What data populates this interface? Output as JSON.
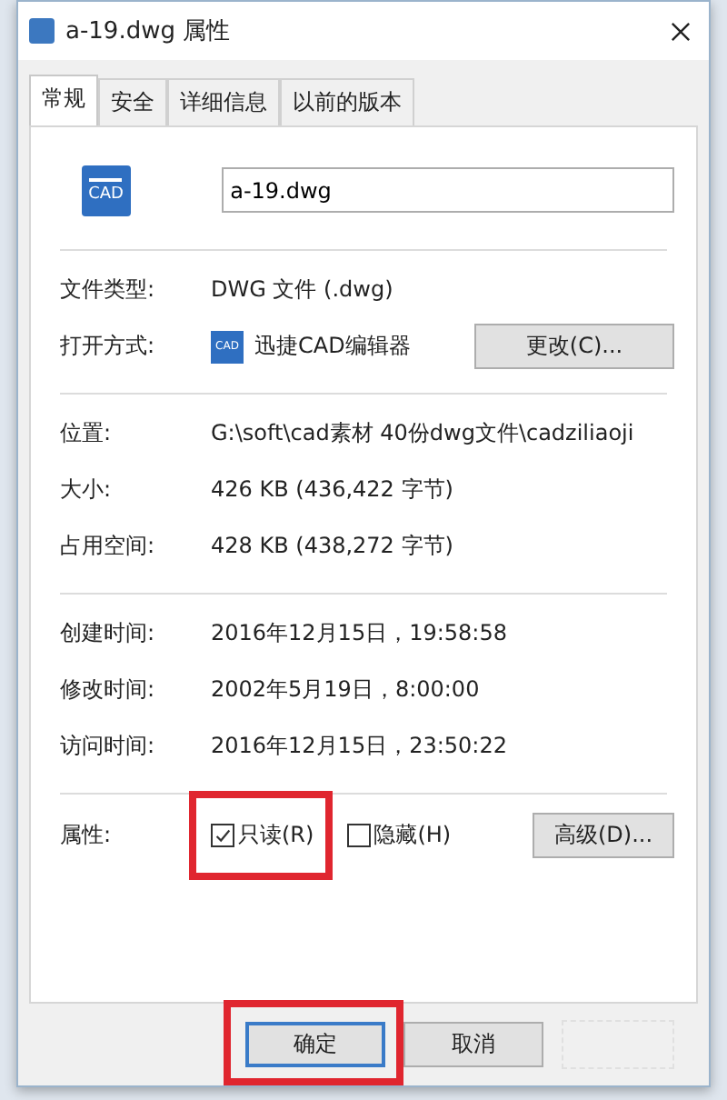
{
  "window": {
    "title": "a-19.dwg 属性"
  },
  "tabs": [
    {
      "label": "常规",
      "selected": true
    },
    {
      "label": "安全",
      "selected": false
    },
    {
      "label": "详细信息",
      "selected": false
    },
    {
      "label": "以前的版本",
      "selected": false
    }
  ],
  "file": {
    "icon_text": "CAD",
    "name": "a-19.dwg"
  },
  "sections": [
    {
      "rows": [
        {
          "kind": "text",
          "label": "文件类型:",
          "value": "DWG 文件 (.dwg)"
        },
        {
          "kind": "app",
          "label": "打开方式:",
          "icon_text": "CAD",
          "value": "迅捷CAD编辑器",
          "button": "更改(C)..."
        }
      ]
    },
    {
      "rows": [
        {
          "kind": "text",
          "label": "位置:",
          "value": "G:\\soft\\cad素材 40份dwg文件\\cadziliaoji"
        },
        {
          "kind": "text",
          "label": "大小:",
          "value": "426 KB (436,422 字节)"
        },
        {
          "kind": "text",
          "label": "占用空间:",
          "value": "428 KB (438,272 字节)"
        }
      ]
    },
    {
      "rows": [
        {
          "kind": "text",
          "label": "创建时间:",
          "value": "2016年12月15日，19:58:58"
        },
        {
          "kind": "text",
          "label": "修改时间:",
          "value": "2002年5月19日，8:00:00"
        },
        {
          "kind": "text",
          "label": "访问时间:",
          "value": "2016年12月15日，23:50:22"
        }
      ]
    }
  ],
  "attributes": {
    "label": "属性:",
    "checkboxes": [
      {
        "label": "只读(R)",
        "checked": true,
        "highlighted": true
      },
      {
        "label": "隐藏(H)",
        "checked": false,
        "highlighted": false
      }
    ],
    "button": "高级(D)..."
  },
  "buttons": [
    {
      "kind": "labeled",
      "label": "确定",
      "default": true,
      "highlighted": true
    },
    {
      "kind": "labeled",
      "label": "取消",
      "default": false,
      "highlighted": false
    },
    {
      "kind": "faded"
    }
  ]
}
